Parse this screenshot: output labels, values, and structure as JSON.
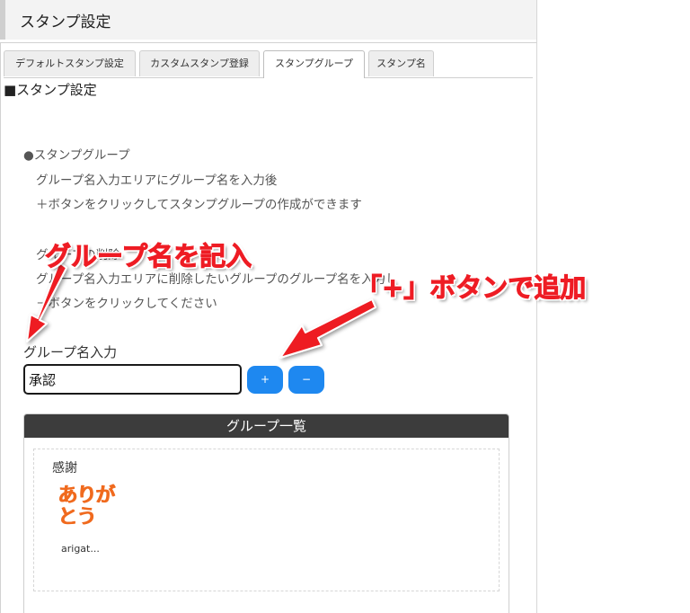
{
  "header": {
    "title": "スタンプ設定"
  },
  "tabs": [
    {
      "label": "デフォルトスタンプ設定",
      "active": false
    },
    {
      "label": "カスタムスタンプ登録",
      "active": false
    },
    {
      "label": "スタンプグループ",
      "active": true
    },
    {
      "label": "スタンプ名",
      "active": false
    }
  ],
  "section_title": "■スタンプ設定",
  "help": {
    "create_heading": "●スタンプグループ",
    "create_line1": "グループ名入力エリアにグループ名を入力後",
    "create_line2": "＋ボタンをクリックしてスタンプグループの作成ができます",
    "delete_heading": "グループの削除",
    "delete_line1": "グループ名入力エリアに削除したいグループのグループ名を入力し",
    "delete_line2": "－ボタンをクリックしてください"
  },
  "form": {
    "label": "グループ名入力",
    "value": "承認",
    "add_label": "+",
    "remove_label": "−"
  },
  "group_list": {
    "title": "グループ一覧",
    "groups": [
      {
        "name": "感謝",
        "stamp_line1": "ありが",
        "stamp_line2": "とう",
        "stamp_caption": "arigat..."
      }
    ]
  },
  "annotations": {
    "left": "グループ名を記入",
    "right": "「+」ボタンで追加"
  },
  "colors": {
    "accent": "#1e88f0",
    "annotation": "#ee1c24",
    "stamp": "#f06a1e",
    "list_header": "#3c3c3c"
  }
}
